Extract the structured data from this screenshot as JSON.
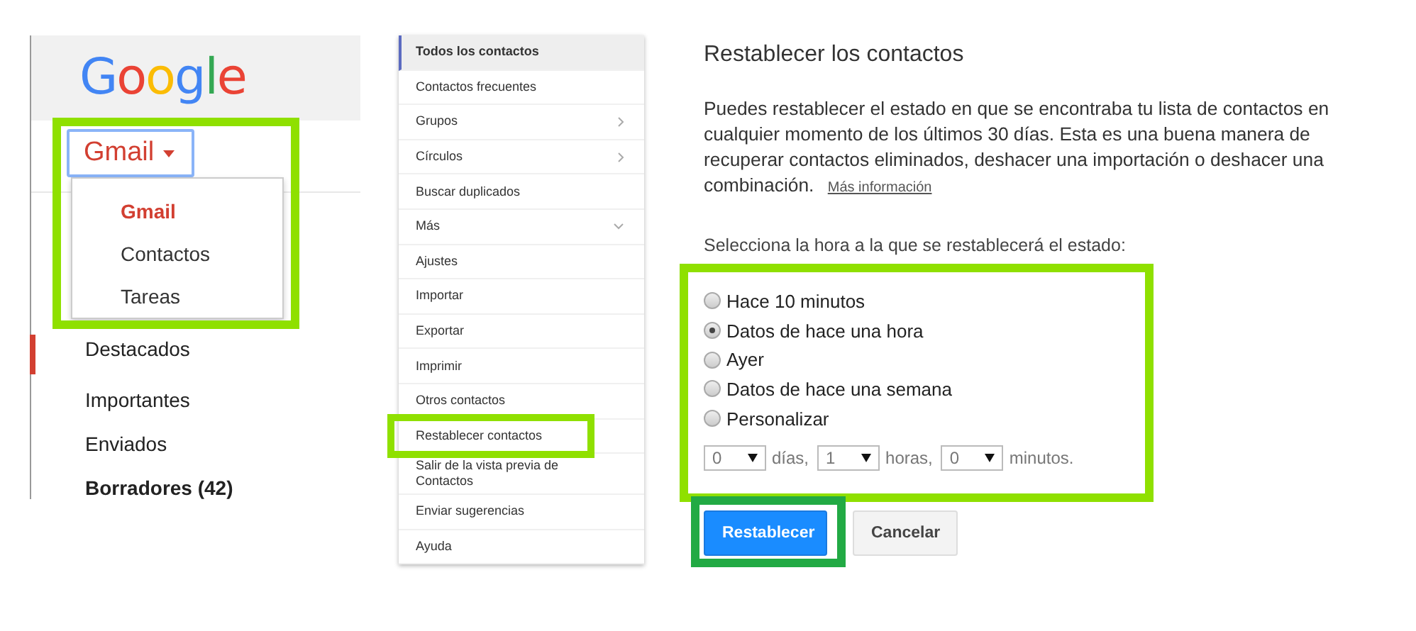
{
  "gmail_panel": {
    "logo": "Google",
    "switcher": {
      "label": "Gmail",
      "highlighted": true
    },
    "menu": [
      {
        "label": "Gmail",
        "selected": true
      },
      {
        "label": "Contactos",
        "selected": false
      },
      {
        "label": "Tareas",
        "selected": false
      }
    ],
    "nav": [
      {
        "label": "Destacados",
        "selected": true,
        "bold": false
      },
      {
        "label": "Importantes",
        "selected": false,
        "bold": false
      },
      {
        "label": "Enviados",
        "selected": false,
        "bold": false
      },
      {
        "label": "Borradores (42)",
        "selected": false,
        "bold": true
      }
    ]
  },
  "contacts_sidebar": {
    "items": [
      {
        "label": "Todos los contactos",
        "selected": true,
        "kind": "plain"
      },
      {
        "label": "Contactos frecuentes",
        "selected": false,
        "kind": "plain"
      },
      {
        "label": "Grupos",
        "selected": false,
        "kind": "submenu"
      },
      {
        "label": "Círculos",
        "selected": false,
        "kind": "submenu"
      },
      {
        "label": "Buscar duplicados",
        "selected": false,
        "kind": "plain"
      },
      {
        "label": "Más",
        "selected": false,
        "kind": "expander"
      },
      {
        "label": "Ajustes",
        "selected": false,
        "kind": "plain"
      },
      {
        "label": "Importar",
        "selected": false,
        "kind": "plain"
      },
      {
        "label": "Exportar",
        "selected": false,
        "kind": "plain"
      },
      {
        "label": "Imprimir",
        "selected": false,
        "kind": "plain"
      },
      {
        "label": "Otros contactos",
        "selected": false,
        "kind": "plain"
      },
      {
        "label": "Restablecer contactos",
        "selected": false,
        "kind": "plain",
        "highlighted": true
      },
      {
        "label": "Salir de la vista previa de Contactos",
        "selected": false,
        "kind": "plain"
      },
      {
        "label": "Enviar sugerencias",
        "selected": false,
        "kind": "plain"
      },
      {
        "label": "Ayuda",
        "selected": false,
        "kind": "plain"
      }
    ]
  },
  "restore_dialog": {
    "title": "Restablecer los contactos",
    "description": "Puedes restablecer el estado en que se encontraba tu lista de contactos en cualquier momento de los últimos 30 días. Esta es una buena manera de recuperar contactos eliminados, deshacer una importación o deshacer una combinación.",
    "link": "Más información",
    "prompt": "Selecciona la hora a la que se restablecerá el estado:",
    "options_highlighted": true,
    "options": [
      {
        "label": "Hace 10 minutos",
        "selected": false
      },
      {
        "label": "Datos de hace una hora",
        "selected": true
      },
      {
        "label": "Ayer",
        "selected": false
      },
      {
        "label": "Datos de hace una semana",
        "selected": false
      },
      {
        "label": "Personalizar",
        "selected": false
      }
    ],
    "custom": [
      {
        "value": "0",
        "unit": "días,"
      },
      {
        "value": "1",
        "unit": "horas,"
      },
      {
        "value": "0",
        "unit": "minutos."
      }
    ],
    "buttons": [
      {
        "label": "Restablecer",
        "kind": "primary",
        "highlighted": true
      },
      {
        "label": "Cancelar",
        "kind": "secondary"
      }
    ]
  }
}
